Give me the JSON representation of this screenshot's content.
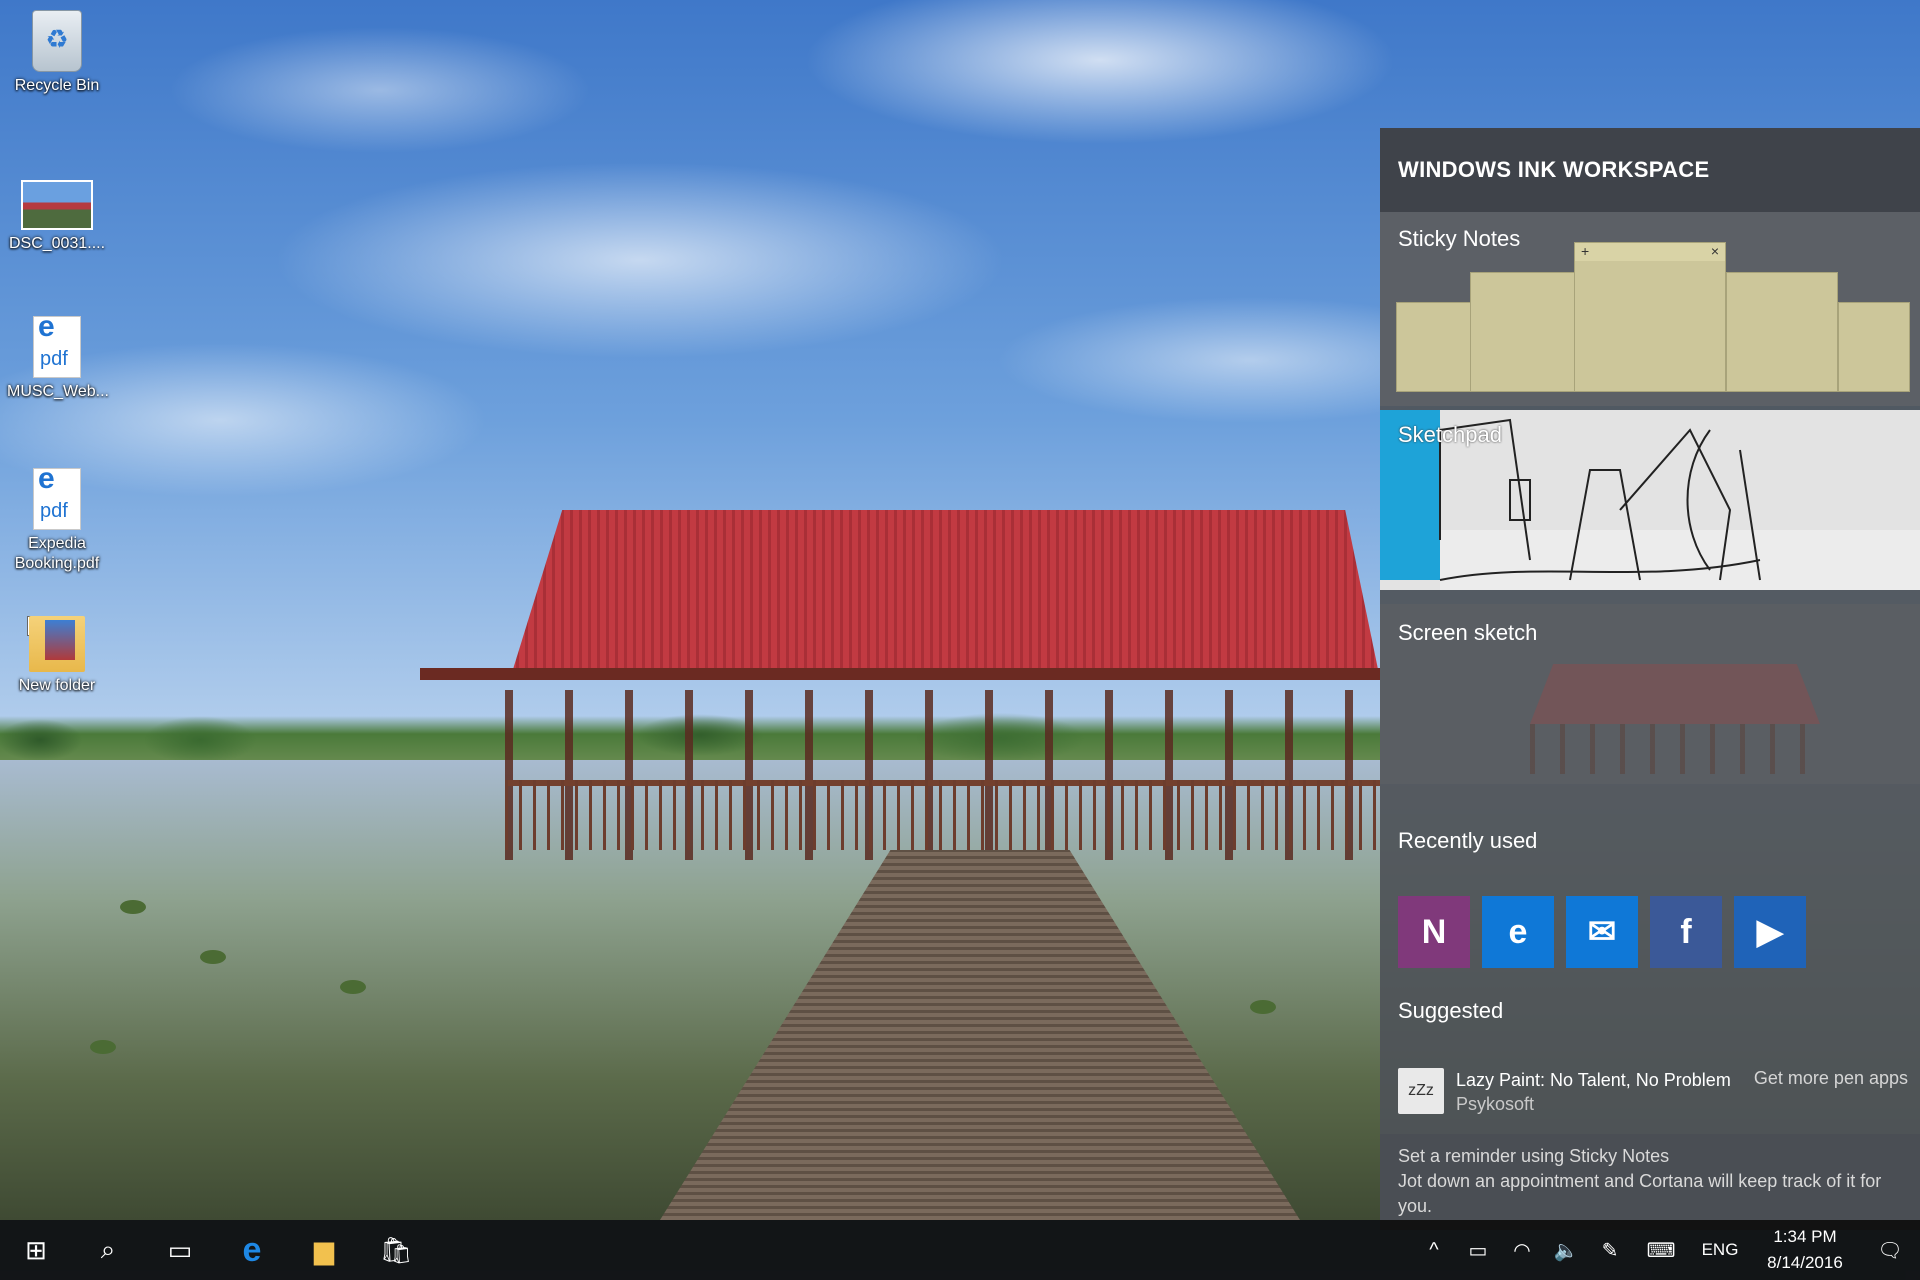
{
  "desktop": {
    "icons": [
      {
        "label": "Recycle Bin",
        "icon": "recycle-bin-icon"
      },
      {
        "label": "DSC_0031....",
        "icon": "image-file-icon"
      },
      {
        "label": "MUSC_Web...",
        "icon": "edge-pdf-icon",
        "badge": "pdf",
        "glyph": "e"
      },
      {
        "label": "Expedia Booking.pdf",
        "icon": "edge-pdf-icon",
        "badge": "pdf",
        "glyph": "e"
      },
      {
        "label": "New folder",
        "icon": "folder-icon",
        "checked": true
      }
    ]
  },
  "ink_workspace": {
    "title": "WINDOWS INK WORKSPACE",
    "sticky_notes": {
      "label": "Sticky Notes",
      "add_glyph": "+",
      "close_glyph": "×"
    },
    "sketchpad": {
      "label": "Sketchpad"
    },
    "screen_sketch": {
      "label": "Screen sketch"
    },
    "recently_used": {
      "label": "Recently used",
      "apps": [
        {
          "name": "onenote-icon",
          "glyph": "N",
          "color": "#80397b"
        },
        {
          "name": "edge-icon",
          "glyph": "e",
          "color": "#0f78d7"
        },
        {
          "name": "messenger-icon",
          "glyph": "✉",
          "color": "#0f78d7"
        },
        {
          "name": "facebook-icon",
          "glyph": "f",
          "color": "#3b5998"
        },
        {
          "name": "play-icon",
          "glyph": "▶",
          "color": "#1f63b8"
        }
      ]
    },
    "suggested": {
      "label": "Suggested",
      "app_name": "Lazy Paint: No Talent, No Problem",
      "publisher": "Psykosoft",
      "icon_glyph": "zZz",
      "more_link": "Get more pen apps"
    },
    "tip": {
      "line1": "Set a reminder using Sticky Notes",
      "line2": "Jot down an appointment and Cortana will keep track of it for you."
    }
  },
  "taskbar": {
    "start_glyph": "⊞",
    "search_glyph": "⌕",
    "taskview_glyph": "▭",
    "pinned": [
      {
        "name": "edge-icon",
        "glyph": "e",
        "color": "#1e88e5"
      },
      {
        "name": "file-explorer-icon",
        "glyph": "▆",
        "color": "#f2c14e"
      },
      {
        "name": "store-icon",
        "glyph": "🛍",
        "color": "#ffffff"
      }
    ],
    "tray": {
      "chevron_glyph": "^",
      "battery_glyph": "▭",
      "wifi_glyph": "◠",
      "volume_glyph": "🔈",
      "pen_glyph": "✎",
      "keyboard_glyph": "⌨",
      "language": "ENG",
      "time": "1:34 PM",
      "date": "8/14/2016",
      "notifications_glyph": "🗨"
    }
  }
}
